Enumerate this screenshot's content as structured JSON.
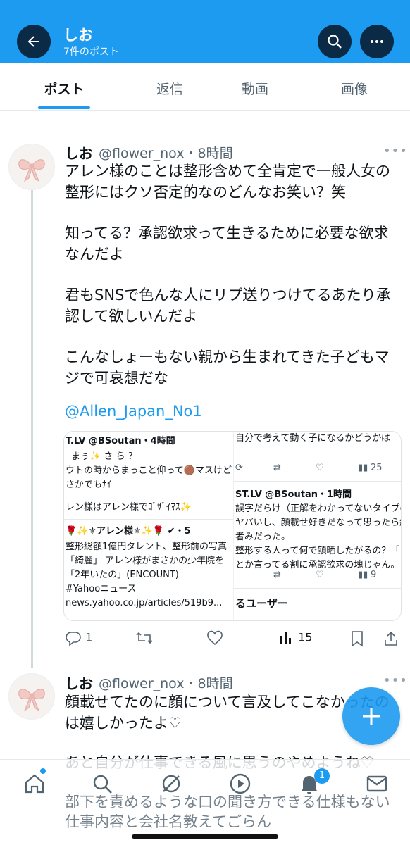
{
  "header": {
    "title": "しお",
    "subtitle": "7件のポスト",
    "accent": "#1d9bf0"
  },
  "tabs": [
    "ポスト",
    "返信",
    "動画",
    "画像"
  ],
  "posts": [
    {
      "name": "しお",
      "handle": "@flower_nox",
      "time": "8時間",
      "lines": [
        "アレン様のことは整形含めて全肯定で一般人女の",
        "整形にはクソ否定的なのどんなお笑い？笑",
        "",
        "知ってる？承認欲求って生きるために必要な欲求",
        "なんだよ",
        "",
        "君もSNSで色んな人にリプ送りつけてるあたり承",
        "認して欲しいんだよ",
        "",
        "こんなしょーもない親から生まれてきた子どもマ",
        "ジで可哀想だな"
      ],
      "mention": "@Allen_Japan_No1",
      "card": {
        "left_lines": [
          "T.LV @BSoutan・4時間",
          "まぅ✨ さ ら ？",
          "ウトの時からまっこと仰って🟤マスけど",
          "さかでもﾅｲ",
          "",
          "レン様はアレン様でｺﾞｻﾞｲﾏｽ✨",
          "",
          "🌹✨⚜アレン様⚜✨🌹 ✔・5",
          "整形総額1億円タレント、整形前の写真",
          "「綺麗」 アレン様がまさかの少年院を",
          "「2年いたの」(ENCOUNT)",
          "#Yahooニュース",
          "news.yahoo.co.jp/articles/519b9..."
        ],
        "right_lines": [
          "自分で考えて動く子になるかどうかは",
          "",
          "",
          "ST.LV @BSoutan・1時間",
          "誤字だらけ（正解をわかってないタイプの",
          "ヤバいし、顔載せ好きだなって思ったら結",
          "者みだった。",
          "整形する人って何で顔晒したがるの？「自分",
          "とか言ってる割に承認欲求の塊じゃん。",
          "",
          "",
          "",
          "るユーザー"
        ],
        "right_stats_top": "25",
        "right_stats_bottom": "9"
      },
      "replies": "1",
      "views": "15"
    },
    {
      "name": "しお",
      "handle": "@flower_nox",
      "time": "8時間",
      "lines": [
        "顔載せてたのに顔について言及してこなかったの",
        "は嬉しかったよ♡",
        "",
        "あと自分が仕事できる風に思うのやめようね♡",
        "部下を責めるような口の聞き方できる仕様もない",
        "仕事内容と会社名教えてごらん"
      ]
    }
  ],
  "nav": {
    "items": [
      "home-icon",
      "search-icon",
      "grok-icon",
      "video-icon",
      "bell-icon",
      "mail-icon"
    ],
    "notification_count": "1"
  }
}
